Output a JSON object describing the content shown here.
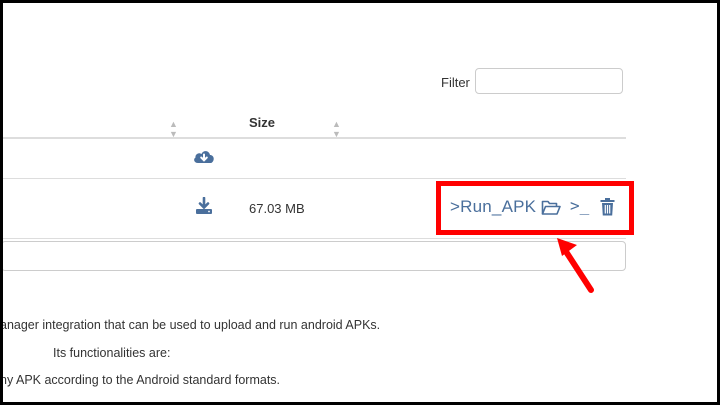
{
  "filter": {
    "label": "Filter",
    "value": "",
    "placeholder": ""
  },
  "table": {
    "columns": [
      {
        "label": ""
      },
      {
        "label": "Size"
      }
    ],
    "rows": [
      {
        "action_icon": "cloud-download-icon",
        "size": ""
      },
      {
        "action_icon": "download-icon",
        "size": "67.03 MB"
      }
    ]
  },
  "actions": {
    "run_apk_label": ">Run_APK",
    "open_icon": "folder-open-icon",
    "terminal_label": ">_",
    "delete_icon": "trash-icon"
  },
  "description": {
    "line1": "anager integration that can be used to upload and run android APKs.",
    "line2": "Its functionalities are:",
    "line3": "ny APK according to the Android standard formats."
  },
  "colors": {
    "accent": "#4a6f9c",
    "highlight": "#ff0000",
    "border": "#dddddd"
  }
}
